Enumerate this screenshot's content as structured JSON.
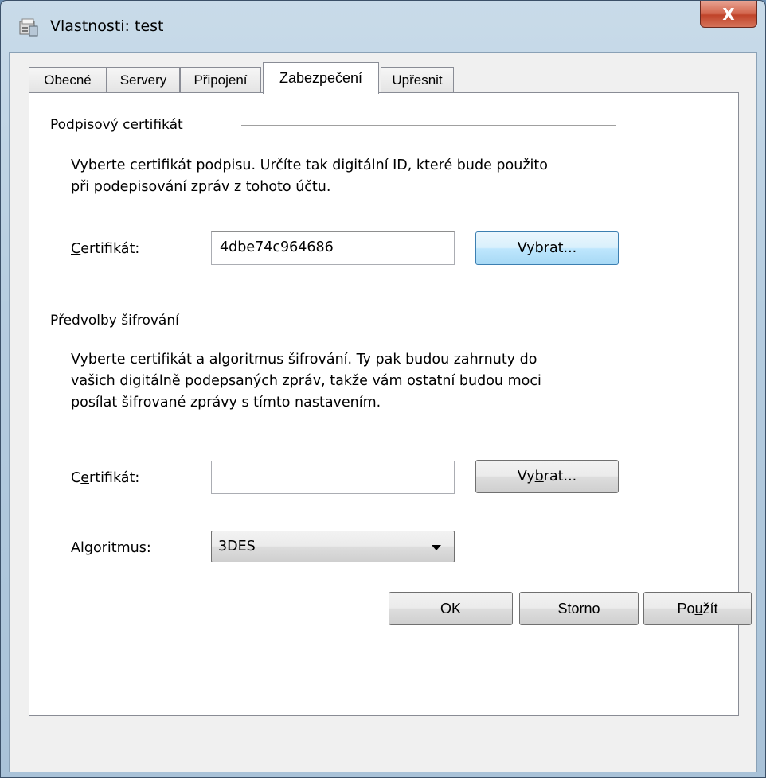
{
  "window": {
    "title": "Vlastnosti: test",
    "close_glyph": "X"
  },
  "tabs": [
    {
      "label": "Obecné"
    },
    {
      "label": "Servery"
    },
    {
      "label": "Připojení"
    },
    {
      "label": "Zabezpečení",
      "active": true
    },
    {
      "label": "Upřesnit"
    }
  ],
  "signing": {
    "group_title": "Podpisový certifikát",
    "description_lines": [
      "Vyberte certifikát podpisu. Určíte tak digitální ID, které bude použito",
      "při podepisování zpráv z tohoto účtu."
    ],
    "cert_label_access": "C",
    "cert_label_rest": "ertifikát:",
    "cert_value": "4dbe74c964686",
    "select_button": "Vybrat..."
  },
  "encryption": {
    "group_title": "Předvolby šifrování",
    "description_lines": [
      "Vyberte certifikát a algoritmus šifrování. Ty pak budou zahrnuty do",
      "vašich digitálně podepsaných zpráv, takže vám ostatní budou moci",
      "posílat šifrované zprávy s tímto nastavením."
    ],
    "cert_label_pre": "C",
    "cert_label_access": "e",
    "cert_label_rest": "rtifikát:",
    "cert_value": "",
    "select_button_pre": "Vy",
    "select_button_access": "b",
    "select_button_rest": "rat...",
    "algorithm_label": "Algoritmus:",
    "algorithm_value": "3DES"
  },
  "footer": {
    "ok": "OK",
    "cancel": "Storno",
    "apply_pre": "Po",
    "apply_access": "u",
    "apply_rest": "žít"
  }
}
